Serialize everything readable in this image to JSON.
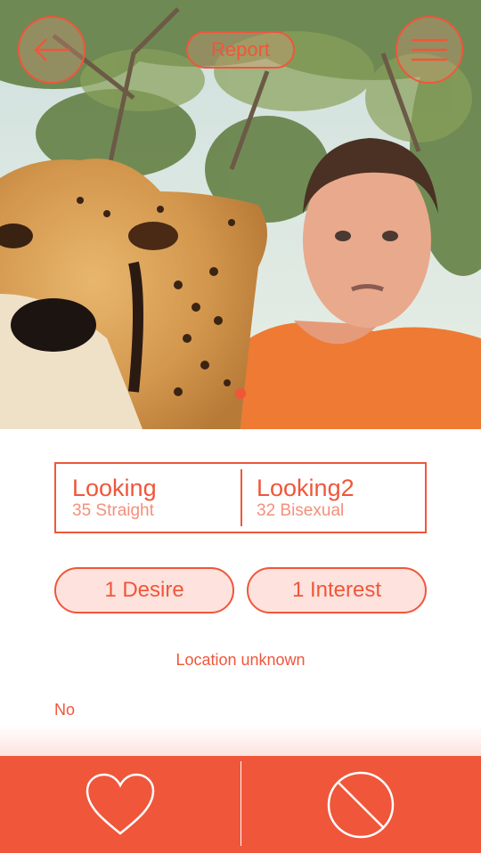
{
  "header": {
    "back_icon": "arrow-left-icon",
    "report_label": "Report",
    "menu_icon": "menu-icon"
  },
  "photo": {
    "description_icon": "profile-photo",
    "pager_count_visible": 1
  },
  "profiles": [
    {
      "name": "Looking",
      "meta": "35 Straight"
    },
    {
      "name": "Looking2",
      "meta": "32 Bisexual"
    }
  ],
  "tags": {
    "desire_label": "1 Desire",
    "interest_label": "1 Interest"
  },
  "location": "Location unknown",
  "bio": "No",
  "actions": {
    "like_icon": "heart-icon",
    "pass_icon": "block-icon"
  },
  "colors": {
    "accent": "#f0563a",
    "pill_fill": "#fde2dd",
    "muted_text": "#f3907c"
  }
}
